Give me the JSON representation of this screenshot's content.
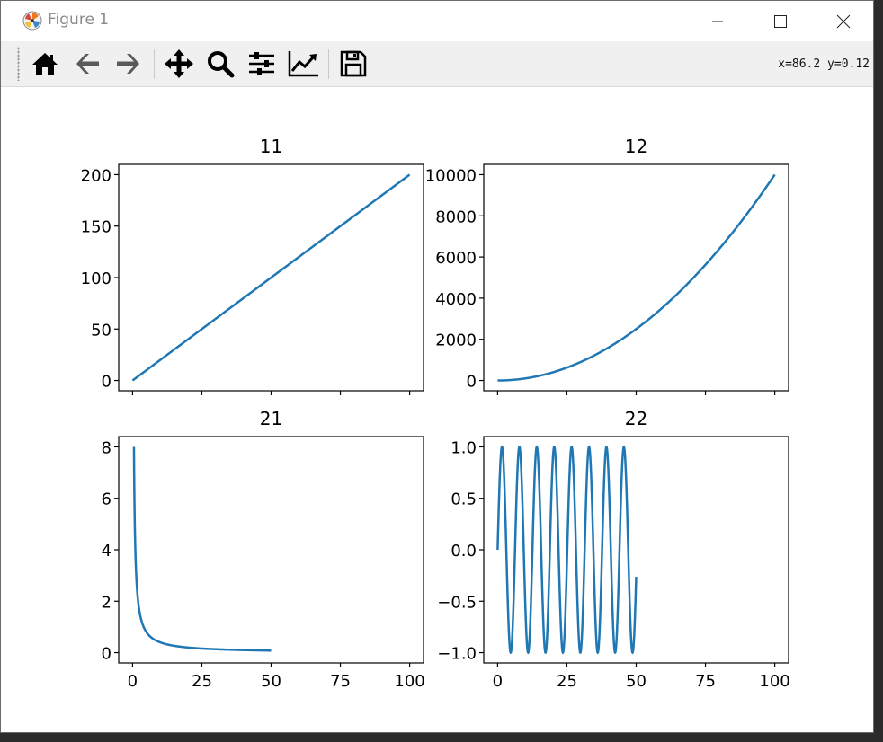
{
  "window": {
    "title": "Figure 1",
    "coords_text": "x=86.2 y=0.12"
  },
  "toolbar": {
    "buttons": [
      {
        "name": "home-button",
        "icon": "home-icon"
      },
      {
        "name": "back-button",
        "icon": "arrow-left-icon"
      },
      {
        "name": "forward-button",
        "icon": "arrow-right-icon"
      },
      {
        "name": "pan-button",
        "icon": "move-icon"
      },
      {
        "name": "zoom-button",
        "icon": "magnifier-icon"
      },
      {
        "name": "configure-subplots-button",
        "icon": "sliders-icon"
      },
      {
        "name": "edit-axes-button",
        "icon": "line-chart-icon"
      },
      {
        "name": "save-button",
        "icon": "floppy-disk-icon"
      }
    ]
  },
  "chart_data": [
    {
      "type": "line",
      "title": "11",
      "xlim": [
        -5,
        105
      ],
      "ylim": [
        -10,
        210
      ],
      "yticks": [
        0,
        50,
        100,
        150,
        200
      ],
      "xticks": [
        0,
        25,
        50,
        75,
        100
      ],
      "xtick_labels_visible": false,
      "function": "y = 2x",
      "series": [
        {
          "x_range": [
            0,
            100
          ],
          "values_at": {
            "0": 0,
            "100": 200
          }
        }
      ],
      "color": "#1f77b4"
    },
    {
      "type": "line",
      "title": "12",
      "xlim": [
        -5,
        105
      ],
      "ylim": [
        -500,
        10500
      ],
      "yticks": [
        0,
        2000,
        4000,
        6000,
        8000,
        10000
      ],
      "xticks": [
        0,
        25,
        50,
        75,
        100
      ],
      "xtick_labels_visible": false,
      "function": "y = x^2",
      "series": [
        {
          "x_range": [
            0,
            100
          ],
          "values_at": {
            "0": 0,
            "50": 2500,
            "100": 10000
          }
        }
      ],
      "color": "#1f77b4"
    },
    {
      "type": "line",
      "title": "21",
      "xlim": [
        -5,
        105
      ],
      "ylim": [
        -0.4,
        8.4
      ],
      "yticks": [
        0,
        2,
        4,
        6,
        8
      ],
      "xticks": [
        0,
        25,
        50,
        75,
        100
      ],
      "function": "y = 4/x",
      "series": [
        {
          "x_range": [
            0.5,
            50
          ],
          "values_at": {
            "0.5": 8,
            "2": 2,
            "50": 0.08
          }
        }
      ],
      "color": "#1f77b4"
    },
    {
      "type": "line",
      "title": "22",
      "xlim": [
        -5,
        105
      ],
      "ylim": [
        -1.1,
        1.1
      ],
      "yticks": [
        -1.0,
        -0.5,
        0.0,
        0.5,
        1.0
      ],
      "ytick_labels": [
        "−1.0",
        "−0.5",
        "0.0",
        "0.5",
        "1.0"
      ],
      "xticks": [
        0,
        25,
        50,
        75,
        100
      ],
      "function": "y = sin(x)",
      "series": [
        {
          "x_range": [
            0,
            50
          ],
          "values_at": {
            "0": 0,
            "50": -0.26
          }
        }
      ],
      "color": "#1f77b4"
    }
  ]
}
